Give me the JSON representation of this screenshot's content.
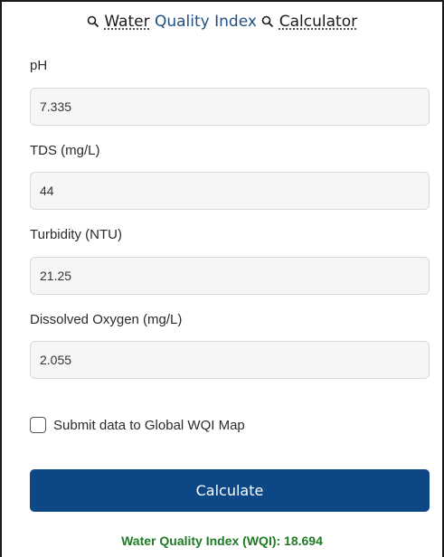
{
  "header": {
    "title_part1": "Water",
    "title_part2": "Quality Index",
    "title_part3": "Calculator"
  },
  "form": {
    "fields": [
      {
        "label": "pH",
        "value": "7.335"
      },
      {
        "label": "TDS (mg/L)",
        "value": "44"
      },
      {
        "label": "Turbidity (NTU)",
        "value": "21.25"
      },
      {
        "label": "Dissolved Oxygen (mg/L)",
        "value": "2.055"
      }
    ],
    "submit_checkbox": {
      "label": "Submit data to Global WQI Map",
      "checked": false
    },
    "calculate_label": "Calculate"
  },
  "result": {
    "text": "Water Quality Index (WQI): 18.694"
  },
  "colors": {
    "button": "#0d4785",
    "result_text": "#1e7a24",
    "title_link": "#1f4f80"
  },
  "icons": [
    "search-icon"
  ]
}
